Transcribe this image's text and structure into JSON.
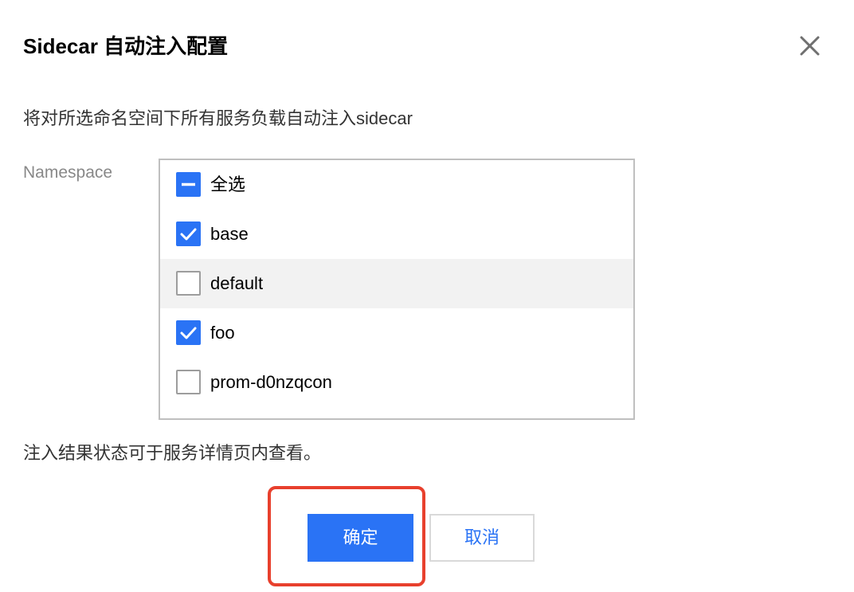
{
  "dialog": {
    "title": "Sidecar 自动注入配置",
    "description": "将对所选命名空间下所有服务负载自动注入sidecar",
    "namespace_label": "Namespace",
    "footnote": "注入结果状态可于服务详情页内查看。"
  },
  "namespace_list": {
    "items": [
      {
        "label": "全选",
        "state": "partial"
      },
      {
        "label": "base",
        "state": "checked"
      },
      {
        "label": "default",
        "state": "unchecked",
        "hovered": true
      },
      {
        "label": "foo",
        "state": "checked"
      },
      {
        "label": "prom-d0nzqcon",
        "state": "unchecked"
      },
      {
        "label": "",
        "state": "checked"
      }
    ]
  },
  "buttons": {
    "confirm_label": "确定",
    "cancel_label": "取消"
  },
  "colors": {
    "accent": "#2a73f5",
    "highlight": "#e8402d",
    "hover_row": "#f2f2f2"
  }
}
